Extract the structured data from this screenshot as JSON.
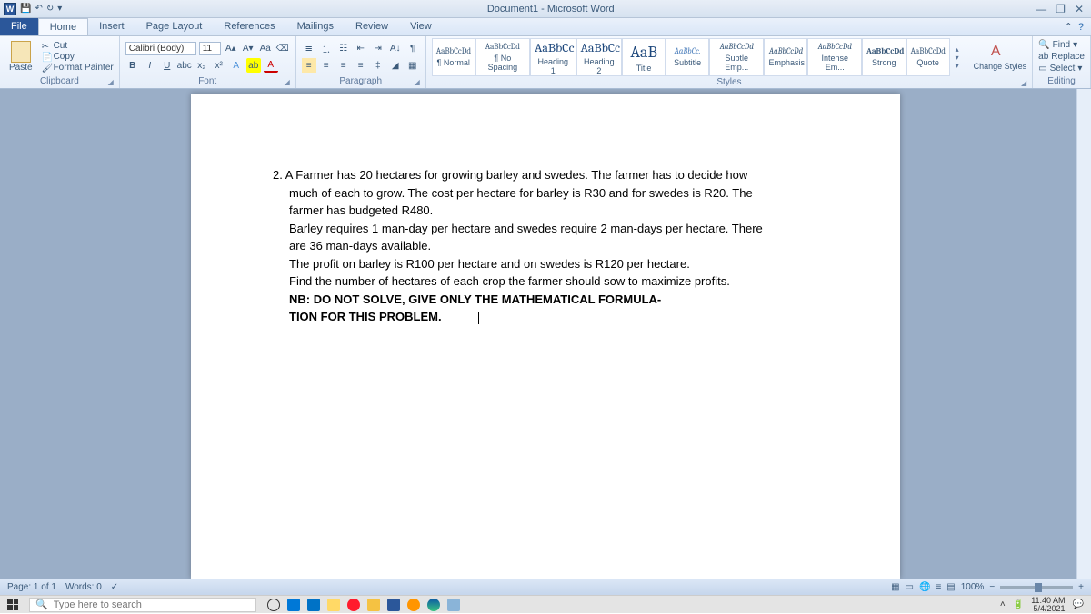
{
  "titlebar": {
    "app_letter": "W",
    "doc_title": "Document1 - Microsoft Word",
    "minimize": "—",
    "maximize": "❐",
    "close": "✕"
  },
  "tabs": {
    "file": "File",
    "home": "Home",
    "insert": "Insert",
    "page_layout": "Page Layout",
    "references": "References",
    "mailings": "Mailings",
    "review": "Review",
    "view": "View"
  },
  "clipboard": {
    "paste": "Paste",
    "cut": "Cut",
    "copy": "Copy",
    "format_painter": "Format Painter",
    "label": "Clipboard"
  },
  "font": {
    "name": "Calibri (Body)",
    "size": "11",
    "label": "Font"
  },
  "paragraph": {
    "label": "Paragraph"
  },
  "styles": {
    "label": "Styles",
    "change": "Change Styles",
    "items": [
      {
        "preview": "AaBbCcDd",
        "name": "¶ Normal"
      },
      {
        "preview": "AaBbCcDd",
        "name": "¶ No Spacing"
      },
      {
        "preview": "AaBbCc",
        "name": "Heading 1"
      },
      {
        "preview": "AaBbCc",
        "name": "Heading 2"
      },
      {
        "preview": "AaB",
        "name": "Title"
      },
      {
        "preview": "AaBbCc.",
        "name": "Subtitle"
      },
      {
        "preview": "AaBbCcDd",
        "name": "Subtle Emp..."
      },
      {
        "preview": "AaBbCcDd",
        "name": "Emphasis"
      },
      {
        "preview": "AaBbCcDd",
        "name": "Intense Em..."
      },
      {
        "preview": "AaBbCcDd",
        "name": "Strong"
      },
      {
        "preview": "AaBbCcDd",
        "name": "Quote"
      }
    ]
  },
  "editing": {
    "find": "Find",
    "replace": "Replace",
    "select": "Select",
    "label": "Editing"
  },
  "document": {
    "p1": "2. A Farmer has 20 hectares for growing barley and swedes. The farmer has to decide how",
    "p2": "much of each to grow. The cost per hectare for barley is R30 and for swedes is R20. The",
    "p3": "farmer has budgeted R480.",
    "p4": "Barley requires 1 man-day per hectare and swedes require 2 man-days per hectare. There",
    "p5": "are 36 man-days available.",
    "p6": "The profit on barley is R100 per hectare and on swedes is R120 per hectare.",
    "p7": "Find the number of hectares of each crop the farmer should sow to maximize profits.",
    "p8": "NB: DO NOT SOLVE, GIVE ONLY THE MATHEMATICAL FORMULA-",
    "p9": "TION FOR THIS PROBLEM."
  },
  "status": {
    "page": "Page: 1 of 1",
    "words": "Words: 0",
    "zoom": "100%"
  },
  "taskbar": {
    "search_placeholder": "Type here to search",
    "time": "11:40 AM",
    "date": "5/4/2021"
  }
}
